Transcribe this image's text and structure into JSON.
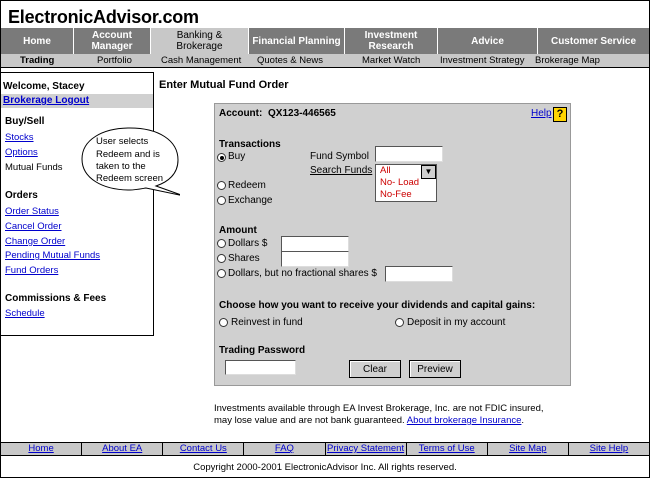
{
  "site": {
    "logo": "ElectronicAdvisor.com"
  },
  "topnav": [
    {
      "label": "Home"
    },
    {
      "label": "Account Manager"
    },
    {
      "label": "Banking & Brokerage"
    },
    {
      "label": "Financial Planning"
    },
    {
      "label": "Investment Research"
    },
    {
      "label": "Advice"
    },
    {
      "label": "Customer Service"
    }
  ],
  "subnav": [
    {
      "label": "Trading"
    },
    {
      "label": "Portfolio"
    },
    {
      "label": "Cash Management"
    },
    {
      "label": "Quotes & News"
    },
    {
      "label": "Market Watch"
    },
    {
      "label": "Investment Strategy"
    },
    {
      "label": "Brokerage Map"
    }
  ],
  "sidebar": {
    "welcome": "Welcome, Stacey",
    "logout": "Brokerage Logout",
    "buysell_heading": "Buy/Sell",
    "stocks": "Stocks",
    "options": "Options",
    "mutual_funds": "Mutual Funds",
    "orders_heading": "Orders",
    "order_status": "Order Status",
    "cancel_order": "Cancel Order",
    "change_order": "Change Order",
    "pending_mutual_funds": "Pending Mutual Funds",
    "fund_orders": "Fund Orders",
    "commissions_heading": "Commissions & Fees",
    "schedule": "Schedule"
  },
  "callout": {
    "line1": "User selects",
    "line2": "Redeem and is",
    "line3": "taken to the",
    "line4": "Redeem screen"
  },
  "page": {
    "title": "Enter Mutual Fund Order"
  },
  "order": {
    "account_label": "Account:",
    "account_number": "QX123-446565",
    "help": "Help",
    "help_icon": "?",
    "transactions_heading": "Transactions",
    "buy": "Buy",
    "redeem": "Redeem",
    "exchange": "Exchange",
    "fund_symbol_label": "Fund Symbol",
    "search_funds": "Search Funds",
    "fund_filter_options": [
      "All",
      "No- Load",
      "No-Fee"
    ],
    "amount_heading": "Amount",
    "dollars": "Dollars $",
    "shares": "Shares",
    "dollars_no_fractional": "Dollars, but no fractional shares $",
    "dividends_heading": "Choose how you want to receive your dividends and capital gains:",
    "reinvest": "Reinvest in fund",
    "deposit": "Deposit in my account",
    "password_heading": "Trading Password",
    "clear": "Clear",
    "preview": "Preview"
  },
  "note": {
    "text": "Investments available through EA Invest Brokerage, Inc. are not FDIC insured, may lose value and are not bank guaranteed.",
    "link": "About brokerage Insurance"
  },
  "footnav": [
    "Home",
    "About EA",
    "Contact Us",
    "FAQ",
    "Privacy Statement",
    "Terms of Use",
    "Site Map",
    "Site Help"
  ],
  "copyright": "Copyright 2000-2001 ElectronicAdvisor Inc. All rights reserved."
}
